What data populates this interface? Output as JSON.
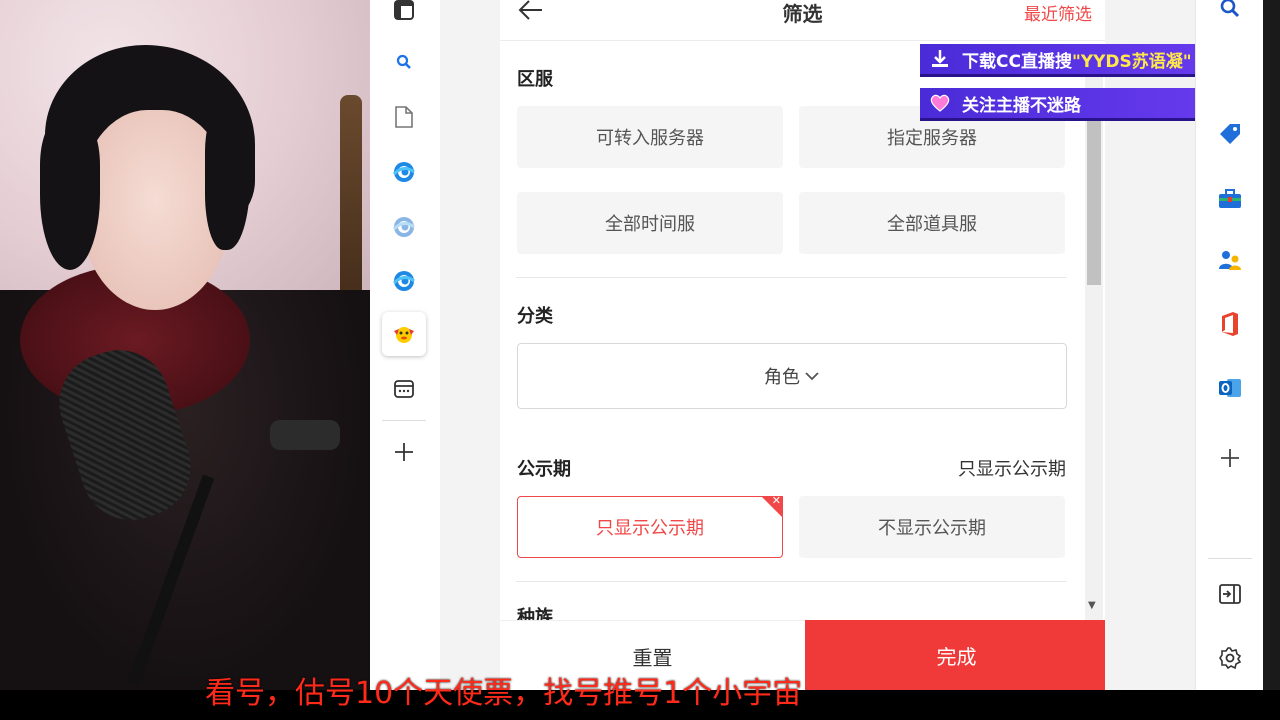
{
  "header": {
    "title": "筛选",
    "recent_label": "最近筛选"
  },
  "server_section": {
    "title": "区服",
    "options": [
      "可转入服务器",
      "指定服务器",
      "全部时间服",
      "全部道具服"
    ]
  },
  "category_section": {
    "title": "分类",
    "dropdown_value": "角色"
  },
  "announce_section": {
    "title": "公示期",
    "current_value": "只显示公示期",
    "options": [
      "只显示公示期",
      "不显示公示期"
    ],
    "selected": "只显示公示期"
  },
  "next_section": {
    "title_partial": "种族"
  },
  "footer": {
    "reset_label": "重置",
    "done_label": "完成"
  },
  "overlay": {
    "banner1_prefix": "下载CC直播搜 ",
    "banner1_highlight": "\"YYDS苏语凝\"",
    "banner2_text": "关注主播不迷路"
  },
  "caption": "看号，估号10个天使票，找号推号1个小宇宙",
  "colors": {
    "accent_red": "#f03a3a",
    "banner_purple": "#5a33e6",
    "caption_red": "#ff2a1a"
  },
  "icons": {
    "left_toolbar": [
      "tab-actions-icon",
      "search-icon",
      "document-icon",
      "edge-icon",
      "edge-icon",
      "edge-icon",
      "game-mascot-icon",
      "calendar-app-icon",
      "add-icon"
    ],
    "right_sidebar": [
      "search-icon",
      "tag-icon",
      "toolbox-icon",
      "people-icon",
      "office-icon",
      "outlook-icon",
      "add-icon",
      "hide-sidebar-icon",
      "settings-icon"
    ]
  }
}
